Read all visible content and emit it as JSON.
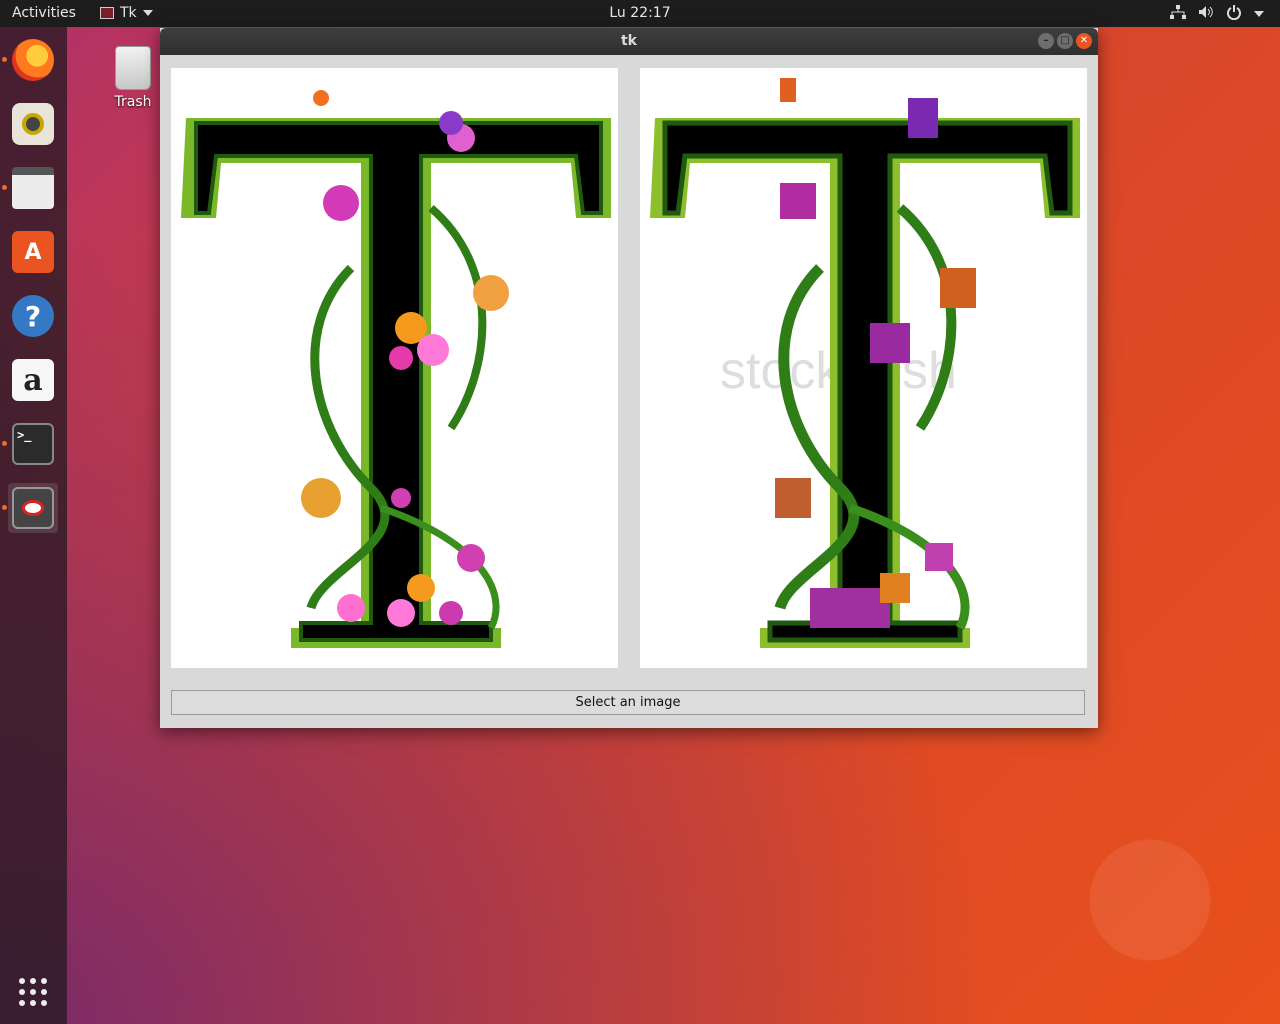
{
  "topbar": {
    "activities": "Activities",
    "app_menu_label": "Tk",
    "clock": "Lu 22:17",
    "tray_icons": [
      "network-icon",
      "volume-icon",
      "power-icon"
    ]
  },
  "dock": {
    "items": [
      {
        "name": "firefox",
        "running": true
      },
      {
        "name": "rhythmbox",
        "running": false
      },
      {
        "name": "files",
        "running": true
      },
      {
        "name": "software-center",
        "running": false
      },
      {
        "name": "help",
        "running": false
      },
      {
        "name": "amazon",
        "running": false
      },
      {
        "name": "terminal",
        "running": true
      },
      {
        "name": "tk-app",
        "running": true,
        "active": true
      }
    ],
    "show_apps_icon": "grid-icon"
  },
  "desktop": {
    "trash_label": "Trash"
  },
  "window": {
    "title": "tk",
    "images": {
      "left": {
        "letter": "T"
      },
      "right": {
        "letter": "T",
        "watermark": "stockfresh"
      }
    },
    "select_button_label": "Select an image"
  },
  "colors": {
    "topbar": "#1d1d1d",
    "accent": "#e95420",
    "window_bg": "#d9d9d9",
    "titlebar": "#333333"
  }
}
